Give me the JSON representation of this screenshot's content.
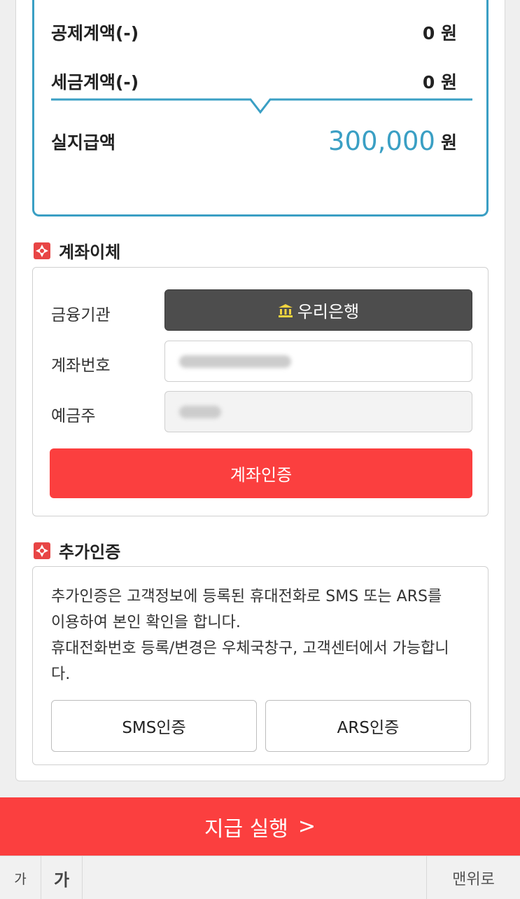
{
  "summary": {
    "deduction_label": "공제계액(-)",
    "deduction_value": "0 원",
    "tax_label": "세금계액(-)",
    "tax_value": "0 원",
    "net_label": "실지급액",
    "net_amount": "300,000",
    "net_unit": "원",
    "accent_color": "#3a9fc4"
  },
  "transfer": {
    "title": "계좌이체",
    "institution_label": "금융기관",
    "bank_name": "우리은행",
    "account_label": "계좌번호",
    "holder_label": "예금주",
    "verify_button": "계좌인증"
  },
  "extra_auth": {
    "title": "추가인증",
    "description": [
      "추가인증은 고객정보에 등록된 휴대전화로 SMS 또는 ARS를",
      "이용하여 본인 확인을 합니다.",
      "휴대전화번호 등록/변경은 우체국창구, 고객센터에서 가능합니",
      "다."
    ],
    "sms_button": "SMS인증",
    "ars_button": "ARS인증"
  },
  "pay_button": {
    "label": "지급 실행",
    "arrow": ">"
  },
  "bottom_bar": {
    "font_small": "가",
    "font_large": "가",
    "to_top": "맨위로"
  },
  "colors": {
    "primary_red": "#fb3f3f",
    "accent_blue": "#3a9fc4",
    "bank_button": "#4d4d4d"
  },
  "icons": {
    "section_icon": "red-cross-icon",
    "bank_icon": "bank-building-icon"
  }
}
